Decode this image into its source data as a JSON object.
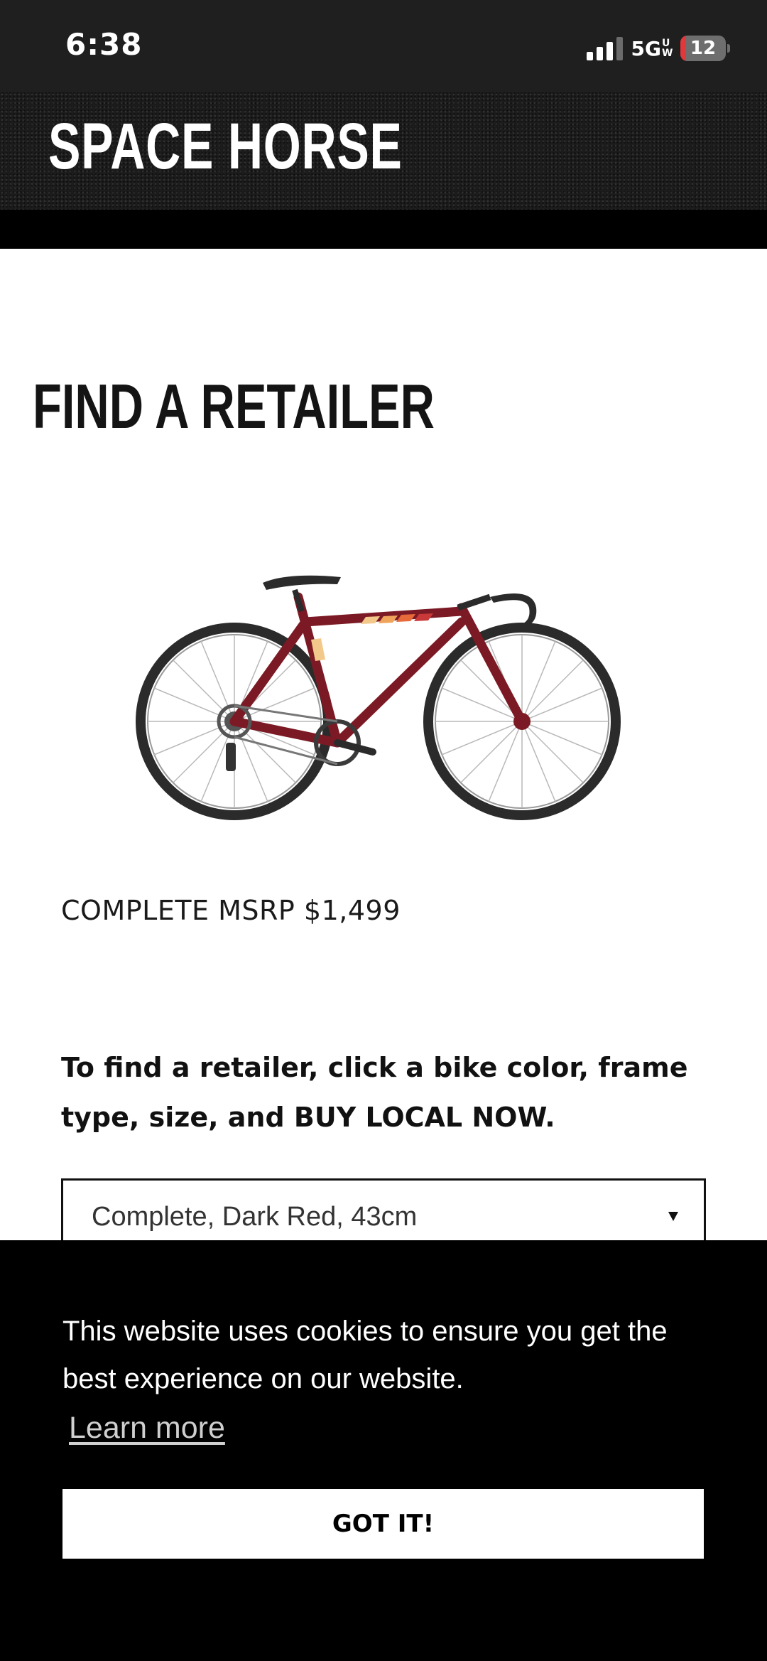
{
  "status_bar": {
    "time": "6:38",
    "network": "5G",
    "network_suffix": "UW",
    "battery_level": "12",
    "battery_fraction": 0.12,
    "signal_bars_active": 3,
    "signal_bars_total": 4
  },
  "header": {
    "brand": "SPACE HORSE"
  },
  "main": {
    "title": "FIND A RETAILER",
    "msrp": "COMPLETE MSRP $1,499",
    "instructions": "To find a retailer, click a bike color, frame type, size, and BUY LOCAL NOW.",
    "variant_select": {
      "selected": "Complete, Dark Red, 43cm"
    },
    "bike_color": "#7b1a24"
  },
  "cookie_banner": {
    "message": "This website uses cookies to ensure you get the best experience on our website.",
    "learn_more": "Learn more",
    "accept_label": "GOT IT!"
  },
  "colors": {
    "status_bar_bg": "#1f1f1f",
    "battery_low": "#e0383b",
    "banner_bg": "#000000",
    "text_dark": "#111111"
  },
  "icons": {
    "signal": "signal-icon",
    "battery": "battery-icon",
    "dropdown": "dropdown-arrow-icon"
  }
}
